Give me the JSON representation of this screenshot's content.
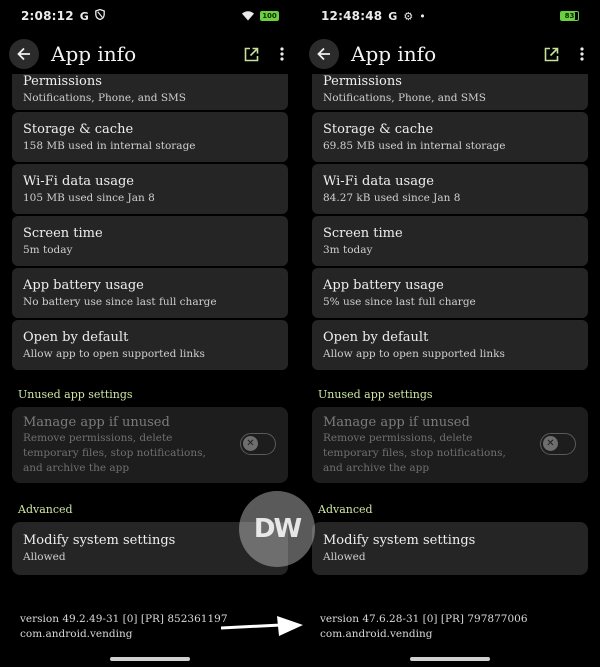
{
  "left": {
    "status": {
      "time": "2:08:12",
      "icons": [
        "google-g-icon",
        "shield-icon"
      ],
      "battery": "100",
      "battery_level": 100
    },
    "appbar": {
      "title": "App info"
    },
    "items": [
      {
        "title": "Permissions",
        "subtitle": "Notifications, Phone, and SMS"
      },
      {
        "title": "Storage & cache",
        "subtitle": "158 MB used in internal storage"
      },
      {
        "title": "Wi-Fi data usage",
        "subtitle": "105 MB used since Jan 8"
      },
      {
        "title": "Screen time",
        "subtitle": "5m today"
      },
      {
        "title": "App battery usage",
        "subtitle": "No battery use since last full charge"
      },
      {
        "title": "Open by default",
        "subtitle": "Allow app to open supported links"
      }
    ],
    "unused_section": "Unused app settings",
    "manage": {
      "title": "Manage app if unused",
      "lines": [
        "Remove permissions, delete",
        "temporary files, stop notifications,",
        "and archive the app"
      ]
    },
    "advanced_section": "Advanced",
    "modify": {
      "title": "Modify system settings",
      "subtitle": "Allowed"
    },
    "version": {
      "line1": "version 49.2.49-31 [0] [PR] 852361197",
      "line2": "com.android.vending"
    }
  },
  "right": {
    "status": {
      "time": "12:48:48",
      "icons": [
        "google-g-icon",
        "gear-icon",
        "dot-icon"
      ],
      "battery": "83",
      "battery_level": 83
    },
    "appbar": {
      "title": "App info"
    },
    "items": [
      {
        "title": "Permissions",
        "subtitle": "Notifications, Phone, and SMS"
      },
      {
        "title": "Storage & cache",
        "subtitle": "69.85 MB used in internal storage"
      },
      {
        "title": "Wi-Fi data usage",
        "subtitle": "84.27 kB used since Jan 8"
      },
      {
        "title": "Screen time",
        "subtitle": "3m today"
      },
      {
        "title": "App battery usage",
        "subtitle": "5% use since last full charge"
      },
      {
        "title": "Open by default",
        "subtitle": "Allow app to open supported links"
      }
    ],
    "unused_section": "Unused app settings",
    "manage": {
      "title": "Manage app if unused",
      "lines": [
        "Remove permissions, delete",
        "temporary files, stop notifications,",
        "and archive the app"
      ]
    },
    "advanced_section": "Advanced",
    "modify": {
      "title": "Modify system settings",
      "subtitle": "Allowed"
    },
    "version": {
      "line1": "version 47.6.28-31 [0] [PR] 797877006",
      "line2": "com.android.vending"
    }
  },
  "watermark": {
    "text": "DW",
    "icon": "dw-logo-watermark"
  },
  "arrow_icon": "right-arrow-icon",
  "colors": {
    "section": "#cde8a4",
    "battery": "#6ccf3f",
    "card": "#252525"
  }
}
